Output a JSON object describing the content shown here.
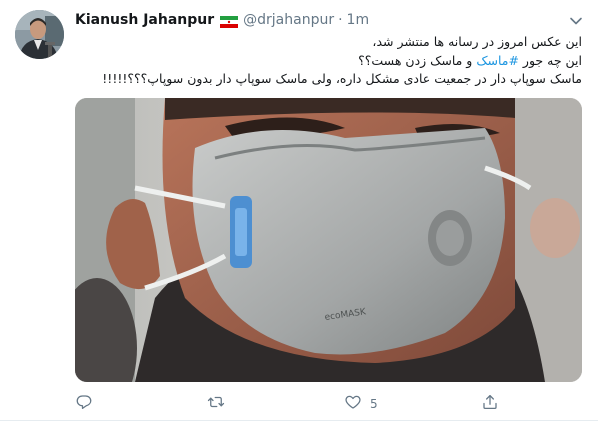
{
  "tweet": {
    "author": {
      "display_name": "Kianush Jahanpur",
      "handle": "@drjahanpur",
      "flag_icon": "iran-flag-icon"
    },
    "separator": "·",
    "timestamp": "1m",
    "menu_icon": "chevron-down-icon",
    "text_lines": [
      "این عکس امروز در رسانه ها منتشر شد،",
      {
        "before": "این چه جور ",
        "hashtag": "#ماسک",
        "after": " و ماسک زدن هست؟؟"
      },
      "ماسک سوپاپ دار در جمعیت عادی مشکل داره، ولی ماسک سوپاپ دار بدون سوپاپ؟؟؟!!!!!"
    ],
    "hashtag_color": "#1b95e0",
    "actions": {
      "reply_icon": "reply-icon",
      "retweet_icon": "retweet-icon",
      "like_icon": "heart-icon",
      "like_count": "5",
      "share_icon": "share-icon"
    }
  },
  "colors": {
    "name": "#14171a",
    "secondary": "#657786",
    "accent": "#1b95e0",
    "border": "#e6ecf0"
  }
}
